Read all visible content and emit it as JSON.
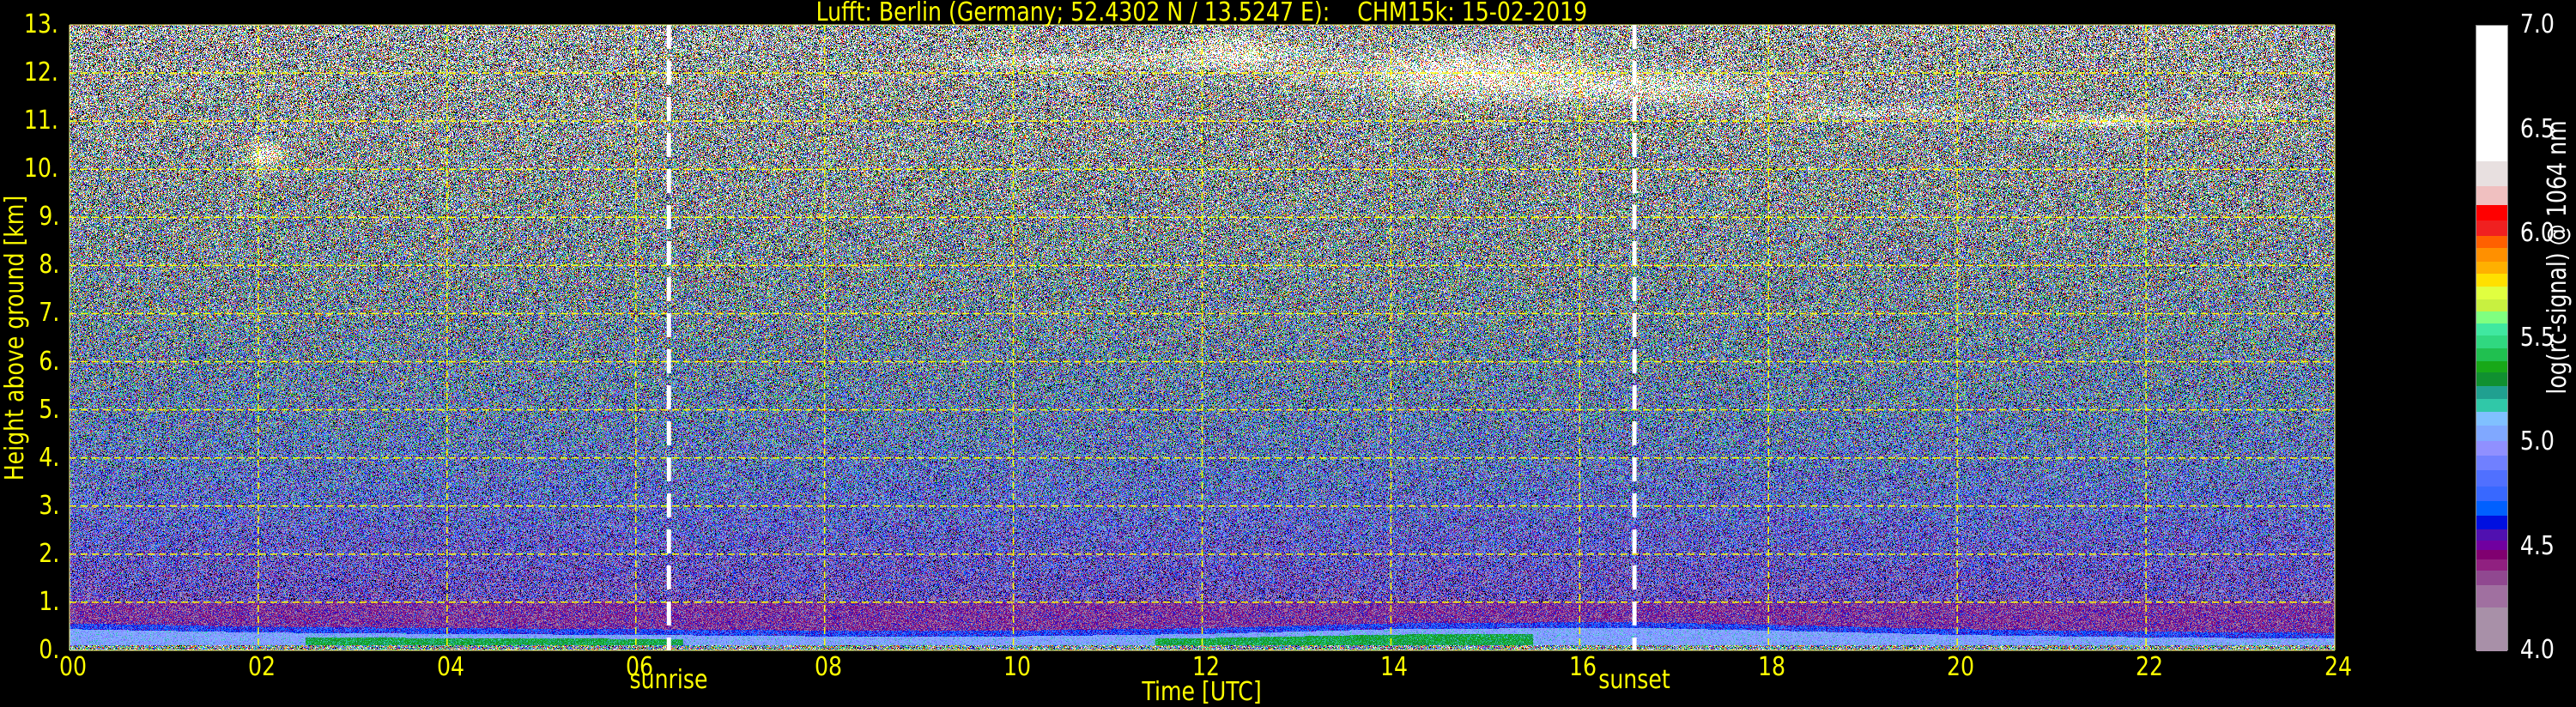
{
  "chart_data": {
    "type": "heatmap",
    "title": "Lufft: Berlin (Germany; 52.4302 N / 13.5247 E):    CHM15k: 15-02-2019",
    "xlabel": "Time [UTC]",
    "ylabel": "Height above ground [km]",
    "xlim": [
      0,
      24
    ],
    "ylim": [
      0,
      13
    ],
    "x_ticks": [
      "00",
      "02",
      "04",
      "06",
      "08",
      "10",
      "12",
      "14",
      "16",
      "18",
      "20",
      "22",
      "24"
    ],
    "x_tick_values": [
      0,
      2,
      4,
      6,
      8,
      10,
      12,
      14,
      16,
      18,
      20,
      22,
      24
    ],
    "y_ticks": [
      "0.",
      "1.",
      "2.",
      "3.",
      "4.",
      "5.",
      "6.",
      "7.",
      "8.",
      "9.",
      "10.",
      "11.",
      "12.",
      "13."
    ],
    "y_tick_values": [
      0,
      1,
      2,
      3,
      4,
      5,
      6,
      7,
      8,
      9,
      10,
      11,
      12,
      13
    ],
    "grid": true,
    "annotations": [
      {
        "label": "sunrise",
        "time": 6.35
      },
      {
        "label": "sunset",
        "time": 16.58
      }
    ],
    "colorbar": {
      "label": "log(rc-signal) @ 1064 nm",
      "range": [
        4.0,
        7.0
      ],
      "ticks": [
        "4.0",
        "4.5",
        "5.0",
        "5.5",
        "6.0",
        "6.5",
        "7.0"
      ],
      "tick_values": [
        4.0,
        4.5,
        5.0,
        5.5,
        6.0,
        6.5,
        7.0
      ],
      "levels": [
        {
          "from": 4.0,
          "color": "#a890a8"
        },
        {
          "from": 4.212,
          "color": "#a070a0"
        },
        {
          "from": 4.32,
          "color": "#904890"
        },
        {
          "from": 4.389,
          "color": "#902080"
        },
        {
          "from": 4.443,
          "color": "#800070"
        },
        {
          "from": 4.489,
          "color": "#7000a0"
        },
        {
          "from": 4.532,
          "color": "#5010b0"
        },
        {
          "from": 4.586,
          "color": "#0010e0"
        },
        {
          "from": 4.653,
          "color": "#0060ff"
        },
        {
          "from": 4.724,
          "color": "#3868ff"
        },
        {
          "from": 4.793,
          "color": "#5070ff"
        },
        {
          "from": 4.871,
          "color": "#7080ff"
        },
        {
          "from": 4.942,
          "color": "#9090ff"
        },
        {
          "from": 5.012,
          "color": "#80a8ff"
        },
        {
          "from": 5.087,
          "color": "#80c0ff"
        },
        {
          "from": 5.15,
          "color": "#30c8a8"
        },
        {
          "from": 5.215,
          "color": "#20a090"
        },
        {
          "from": 5.277,
          "color": "#109030"
        },
        {
          "from": 5.34,
          "color": "#18a818"
        },
        {
          "from": 5.396,
          "color": "#20c050"
        },
        {
          "from": 5.459,
          "color": "#30d880"
        },
        {
          "from": 5.519,
          "color": "#40e8a0"
        },
        {
          "from": 5.576,
          "color": "#80ff80"
        },
        {
          "from": 5.636,
          "color": "#c8f040"
        },
        {
          "from": 5.692,
          "color": "#e0ff40"
        },
        {
          "from": 5.753,
          "color": "#ffe000"
        },
        {
          "from": 5.816,
          "color": "#ffb000"
        },
        {
          "from": 5.876,
          "color": "#ff9000"
        },
        {
          "from": 5.939,
          "color": "#ff6000"
        },
        {
          "from": 5.999,
          "color": "#f02020"
        },
        {
          "from": 6.071,
          "color": "#ff0000"
        },
        {
          "from": 6.146,
          "color": "#f0c0c0"
        },
        {
          "from": 6.237,
          "color": "#e8e0e0"
        },
        {
          "from": 6.358,
          "color": "#ffffff"
        }
      ]
    },
    "features": {
      "boundary_layer_top_km": [
        [
          0,
          0.45
        ],
        [
          2,
          0.38
        ],
        [
          4,
          0.35
        ],
        [
          6,
          0.33
        ],
        [
          8,
          0.3
        ],
        [
          10,
          0.3
        ],
        [
          12,
          0.35
        ],
        [
          14,
          0.45
        ],
        [
          16.5,
          0.48
        ],
        [
          18,
          0.42
        ],
        [
          20,
          0.33
        ],
        [
          22,
          0.28
        ],
        [
          24,
          0.25
        ]
      ],
      "clouds": [
        {
          "time": 2.05,
          "height": 10.3,
          "dt": 0.15,
          "dh": 0.2,
          "strength": 1.3
        },
        {
          "time": 10.5,
          "height": 12.25,
          "dt": 0.8,
          "dh": 0.12,
          "strength": 0.9
        },
        {
          "time": 12.3,
          "height": 12.4,
          "dt": 0.5,
          "dh": 0.25,
          "strength": 1.2
        },
        {
          "time": 14.8,
          "height": 12.0,
          "dt": 0.9,
          "dh": 0.35,
          "strength": 1.4
        },
        {
          "time": 16.8,
          "height": 11.7,
          "dt": 0.9,
          "dh": 0.25,
          "strength": 1.0
        },
        {
          "time": 19.0,
          "height": 11.2,
          "dt": 0.8,
          "dh": 0.12,
          "strength": 0.7
        },
        {
          "time": 21.6,
          "height": 11.0,
          "dt": 0.5,
          "dh": 0.12,
          "strength": 1.0
        },
        {
          "time": 23.0,
          "height": 11.3,
          "dt": 0.4,
          "dh": 0.1,
          "strength": 0.7
        }
      ]
    },
    "colors": {
      "axis_text": "#ffff00",
      "grid": "#ffff00",
      "marker_line": "#ffffff",
      "background": "#000000"
    }
  }
}
